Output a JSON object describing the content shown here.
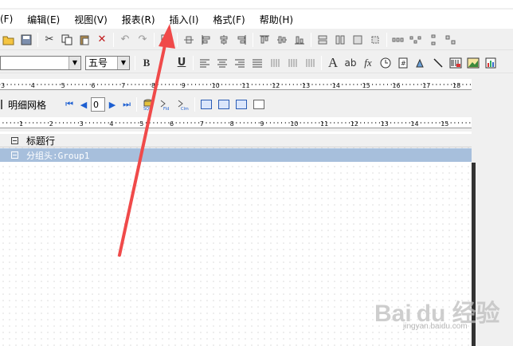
{
  "menu": {
    "items": [
      "(F)",
      "编辑(E)",
      "视图(V)",
      "报表(R)",
      "插入(I)",
      "格式(F)",
      "帮助(H)"
    ]
  },
  "format_toolbar": {
    "font_size_value": "五号",
    "bold_label": "B",
    "underline_label": "U",
    "text_label": "A",
    "ab_label": "ab",
    "fx_label": "fx"
  },
  "ruler": {
    "marks": [
      "3",
      "4",
      "5",
      "6",
      "7",
      "8",
      "9",
      "10",
      "11",
      "12",
      "13",
      "14",
      "15",
      "16",
      "17",
      "18"
    ]
  },
  "navbar": {
    "label": "明细网格",
    "page_value": "0"
  },
  "ruler2": {
    "marks": [
      "1",
      "2",
      "3",
      "4",
      "5",
      "6",
      "7",
      "8",
      "9",
      "10",
      "11",
      "12",
      "13",
      "14",
      "15"
    ]
  },
  "bands": {
    "title_label": "标题行",
    "group_label": "分组头:Group1"
  },
  "watermark": {
    "brand": "Bai du 经验",
    "url": "jingyan.baidu.com"
  },
  "colors": {
    "arrow": "#f04a4a",
    "group_band": "#a7bfdc",
    "nav_blue": "#1d5fd1"
  }
}
